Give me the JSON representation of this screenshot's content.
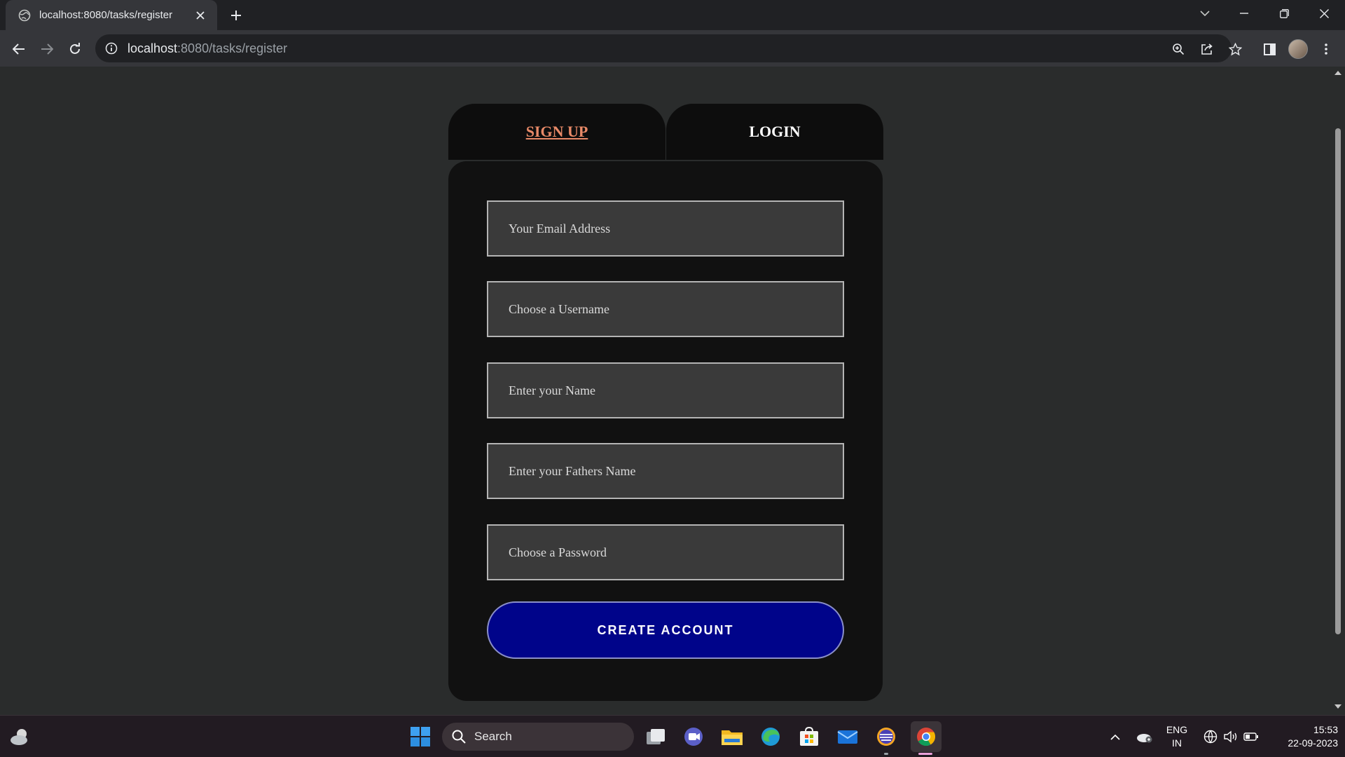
{
  "browser": {
    "tab_title": "localhost:8080/tasks/register",
    "url_host": "localhost",
    "url_path": ":8080/tasks/register"
  },
  "auth_tabs": {
    "signup_label": "SIGN UP",
    "login_label": "LOGIN"
  },
  "form": {
    "fields": [
      {
        "placeholder": "Your Email Address",
        "value": ""
      },
      {
        "placeholder": "Choose a Username",
        "value": ""
      },
      {
        "placeholder": "Enter your Name",
        "value": ""
      },
      {
        "placeholder": "Enter your Fathers Name",
        "value": ""
      },
      {
        "placeholder": "Choose a Password",
        "value": ""
      }
    ],
    "submit_label": "CREATE ACCOUNT"
  },
  "taskbar": {
    "search_label": "Search",
    "language": "ENG",
    "region": "IN",
    "time": "15:53",
    "date": "22-09-2023"
  },
  "colors": {
    "page_bg": "#2a2c2c",
    "card_bg": "#111111",
    "signup_accent": "#e88a68",
    "button_bg": "#00048a"
  },
  "icons": [
    "globe-icon",
    "close-icon",
    "plus-icon",
    "chevron-down-icon",
    "minimize-icon",
    "restore-icon",
    "back-icon",
    "forward-icon",
    "reload-icon",
    "info-icon",
    "zoom-icon",
    "share-icon",
    "star-icon",
    "side-panel-icon",
    "avatar",
    "kebab-menu-icon",
    "weather-icon",
    "windows-start-icon",
    "search-icon",
    "task-view-icon",
    "teams-icon",
    "file-explorer-icon",
    "edge-icon",
    "store-icon",
    "mail-icon",
    "app-icon",
    "chrome-icon",
    "tray-chevron-icon",
    "onedrive-icon",
    "network-icon",
    "volume-icon",
    "battery-icon"
  ]
}
